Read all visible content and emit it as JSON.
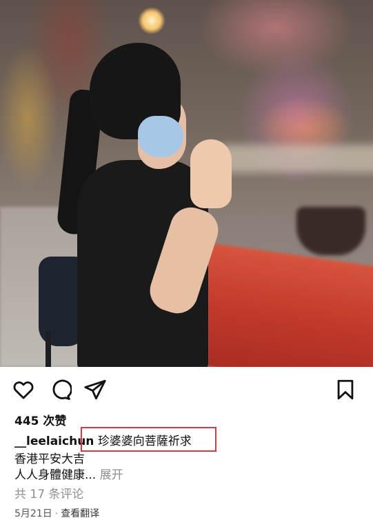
{
  "post": {
    "likes_text": "445 次赞",
    "username": "__leelaichun",
    "caption_line1": "珍婆婆向菩薩祈求",
    "caption_line2": "香港平安大吉",
    "caption_line3": "人人身體健康...",
    "more_label": "展开",
    "comments_text": "共 17 条评论",
    "date": "5月21日",
    "meta_separator": "·",
    "translate_label": "查看翻译"
  },
  "icons": {
    "like": "heart-icon",
    "comment": "comment-bubble-icon",
    "share": "paper-plane-icon",
    "save": "bookmark-icon"
  },
  "colors": {
    "highlight_border": "#d9373f",
    "text": "#111111",
    "muted": "#8e8e8e"
  }
}
